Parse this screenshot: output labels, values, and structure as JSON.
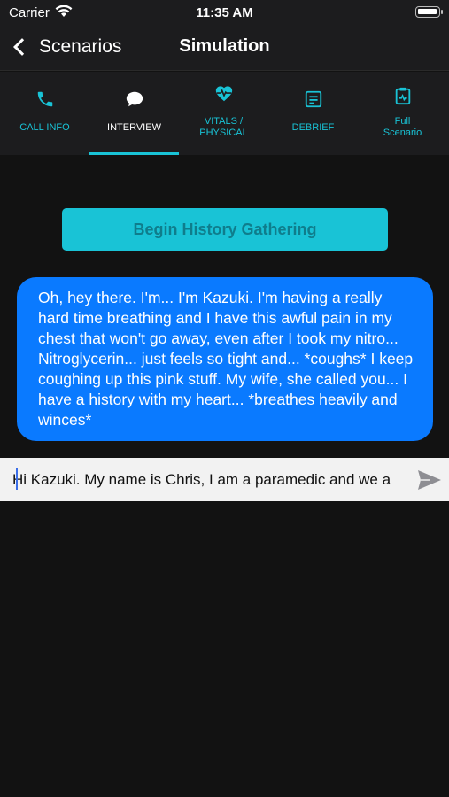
{
  "status_bar": {
    "carrier": "Carrier",
    "time": "11:35 AM"
  },
  "nav": {
    "back_label": "Scenarios",
    "title": "Simulation"
  },
  "tabs": [
    {
      "label": "CALL INFO",
      "icon": "phone-icon"
    },
    {
      "label": "INTERVIEW",
      "icon": "chat-bubble-icon",
      "active": true
    },
    {
      "label": "VITALS /\nPHYSICAL",
      "icon": "heartbeat-icon"
    },
    {
      "label": "DEBRIEF",
      "icon": "document-icon"
    },
    {
      "label": "Full\nScenario",
      "icon": "clipboard-icon"
    }
  ],
  "begin_button_label": "Begin History Gathering",
  "message": "Oh, hey there. I'm... I'm Kazuki. I'm having a really hard time breathing and I have this awful pain in my chest that won't go away, even after I took my nitro... Nitroglycerin... just feels so tight and... *coughs* I keep coughing up this pink stuff. My wife, she called you... I have a history with my heart... *breathes heavily and winces*",
  "input_value": "Hi Kazuki. My name is Chris, I am a paramedic and we a",
  "colors": {
    "accent": "#19c3d6",
    "bubble": "#0a7aff",
    "background": "#121212",
    "bar": "#1c1c1e"
  }
}
